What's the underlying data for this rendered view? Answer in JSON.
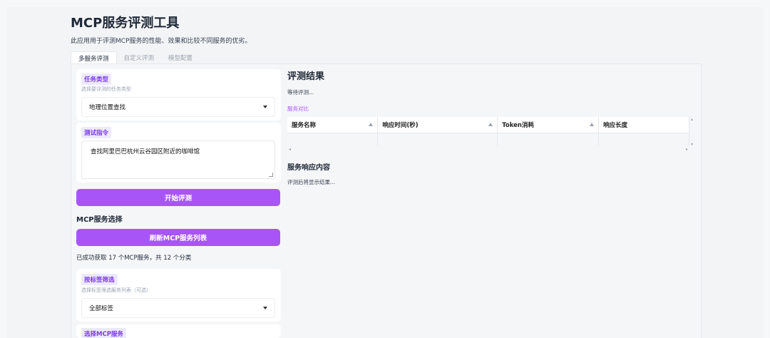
{
  "app": {
    "title": "MCP服务评测工具",
    "description": "此应用用于评测MCP服务的性能、效果和比较不同服务的优劣。"
  },
  "tabs": [
    {
      "label": "多服务评测",
      "active": true
    },
    {
      "label": "自定义评测",
      "active": false
    },
    {
      "label": "模型配置",
      "active": false
    }
  ],
  "task": {
    "label": "任务类型",
    "hint": "选择要评测的任务类型",
    "value": "地理位置查找"
  },
  "instruction": {
    "label": "测试指令",
    "value": "查找阿里巴巴杭州云谷园区附近的咖啡馆"
  },
  "start_button": "开始评测",
  "mcp_section": {
    "title": "MCP服务选择",
    "refresh_button": "刷新MCP服务列表",
    "status": "已成功获取 17 个MCP服务，共 12 个分类"
  },
  "tag_filter": {
    "label": "按标签筛选",
    "hint": "选择标签筛选服务列表（可选）",
    "value": "全部标签"
  },
  "select_mcp_label": "选择MCP服务",
  "results": {
    "title": "评测结果",
    "status": "等待评测...",
    "compare_label": "服务对比",
    "columns": [
      "服务名称",
      "响应时间(秒)",
      "Token消耗",
      "响应长度"
    ],
    "response_title": "服务响应内容",
    "response_text": "评测后将显示结果..."
  },
  "colors": {
    "accent": "#a855f7",
    "chip_bg": "#ede9fe",
    "chip_text": "#7c3aed"
  }
}
